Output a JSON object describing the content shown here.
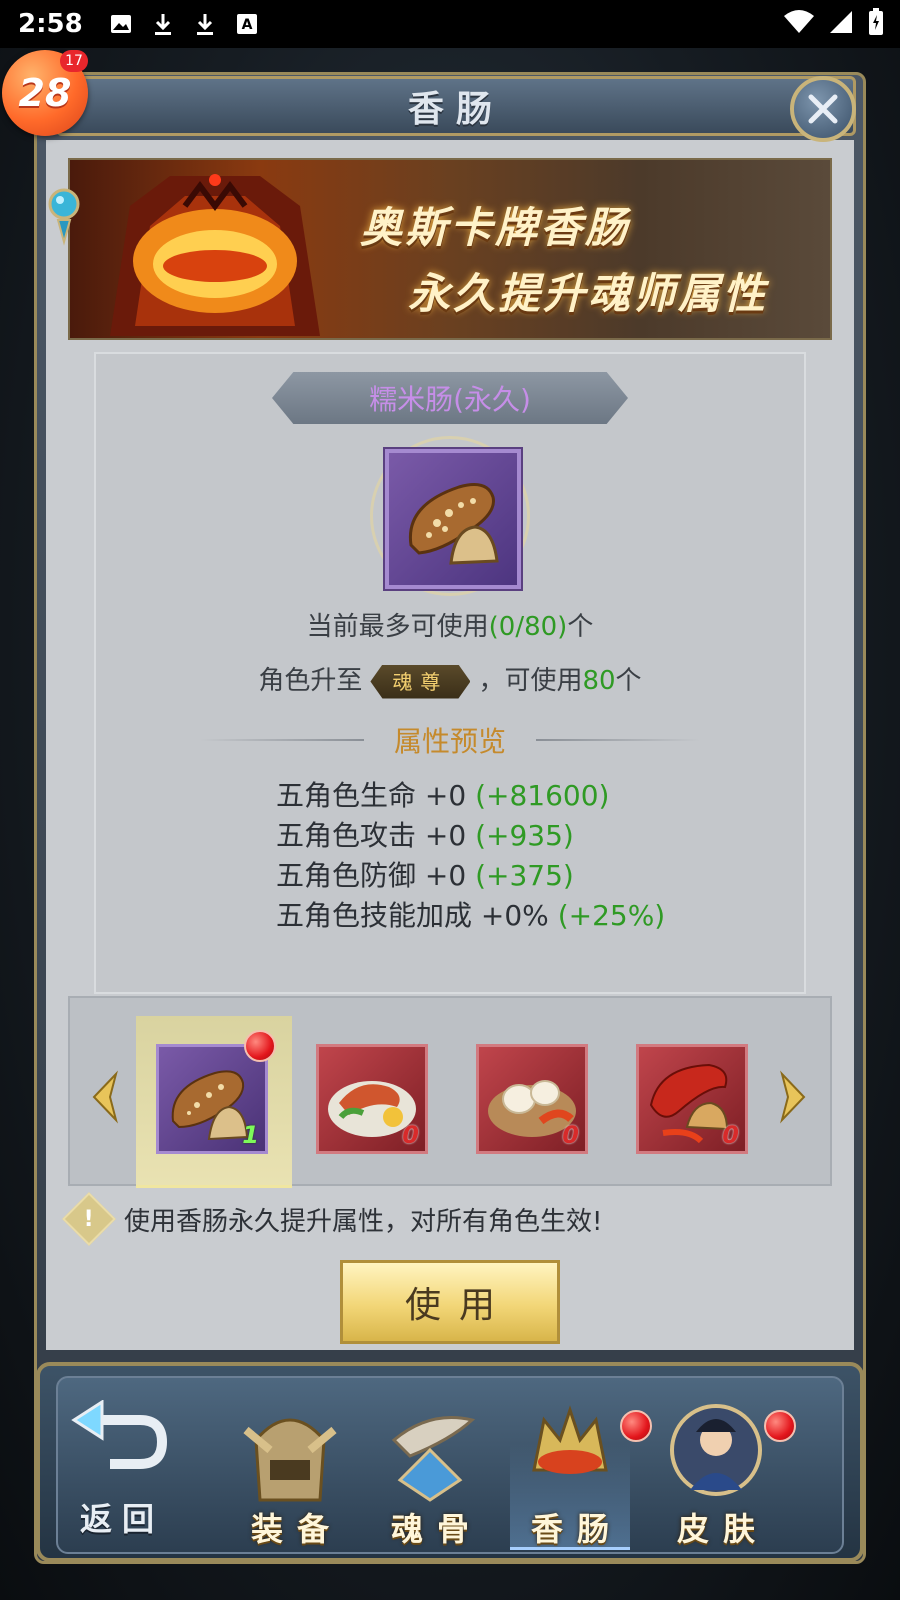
{
  "status_bar": {
    "time": "2:58",
    "icons": [
      "image-icon",
      "download-icon",
      "download-icon",
      "font-icon"
    ],
    "right_icons": [
      "wifi-icon",
      "signal-icon",
      "battery-icon"
    ]
  },
  "float_badge": {
    "number": "28",
    "notification_count": "17"
  },
  "window": {
    "title": "香肠",
    "banner": {
      "line1": "奥斯卡牌香肠",
      "line2": "永久提升魂师属性"
    }
  },
  "item": {
    "name": "糯米肠(永久)",
    "usage_prefix": "当前最多可使用",
    "usage_value": "(0/80)",
    "usage_suffix": "个",
    "rank_prefix": "角色升至",
    "rank_badge": "魂尊",
    "rank_mid": "，可使用",
    "rank_value": "80",
    "rank_suffix": "个"
  },
  "preview": {
    "title": "属性预览",
    "stats": [
      {
        "label": "五角色生命 +0 ",
        "bonus": "(+81600)"
      },
      {
        "label": "五角色攻击 +0 ",
        "bonus": "(+935)"
      },
      {
        "label": "五角色防御 +0 ",
        "bonus": "(+375)"
      },
      {
        "label": "五角色技能加成 +0% ",
        "bonus": "(+25%)"
      }
    ]
  },
  "inventory": [
    {
      "name": "glutinous-rice-sausage",
      "count": "1",
      "rarity": "purple",
      "has_dot": true
    },
    {
      "name": "sausage-platter",
      "count": "0",
      "rarity": "red",
      "has_dot": false
    },
    {
      "name": "rice-roll-plate",
      "count": "0",
      "rarity": "red",
      "has_dot": false
    },
    {
      "name": "red-sausage",
      "count": "0",
      "rarity": "red",
      "has_dot": false
    }
  ],
  "tip": "使用香肠永久提升属性，对所有角色生效!",
  "use_button": "使用",
  "nav": {
    "back": "返回",
    "items": [
      {
        "label": "装备",
        "active": false,
        "dot": false
      },
      {
        "label": "魂骨",
        "active": false,
        "dot": false
      },
      {
        "label": "香肠",
        "active": true,
        "dot": true
      },
      {
        "label": "皮肤",
        "active": false,
        "dot": true
      }
    ]
  },
  "colors": {
    "accent_gold": "#c9b47a",
    "bonus_green": "#2f9a24",
    "item_name_purple": "#c68ee8",
    "preview_orange": "#c58a2c"
  }
}
